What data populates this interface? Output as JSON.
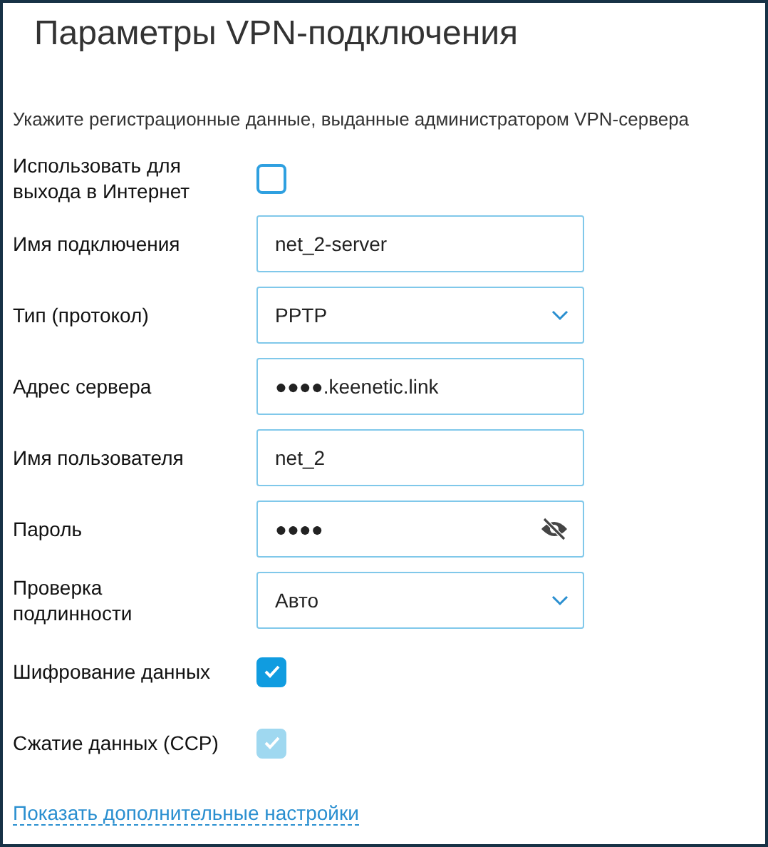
{
  "title": "Параметры VPN-подключения",
  "subtitle": "Укажите регистрационные данные, выданные администратором VPN-сервера",
  "fields": [
    {
      "kind": "checkbox",
      "label": "Использовать для выхода в Интернет",
      "checked": false,
      "disabled": false
    },
    {
      "kind": "text",
      "label": "Имя подключения",
      "value": "net_2-server"
    },
    {
      "kind": "select",
      "label": "Тип (протокол)",
      "value": "PPTP"
    },
    {
      "kind": "text",
      "label": "Адрес сервера",
      "value": "●●●●.keenetic.link"
    },
    {
      "kind": "text",
      "label": "Имя пользователя",
      "value": "net_2"
    },
    {
      "kind": "password",
      "label": "Пароль",
      "value": "●●●●"
    },
    {
      "kind": "select",
      "label": "Проверка подлинности",
      "value": "Авто"
    },
    {
      "kind": "checkbox",
      "label": "Шифрование данных",
      "checked": true,
      "disabled": false
    },
    {
      "kind": "checkbox",
      "label": "Сжатие данных (CCP)",
      "checked": true,
      "disabled": true
    }
  ],
  "link": "Показать дополнительные настройки"
}
